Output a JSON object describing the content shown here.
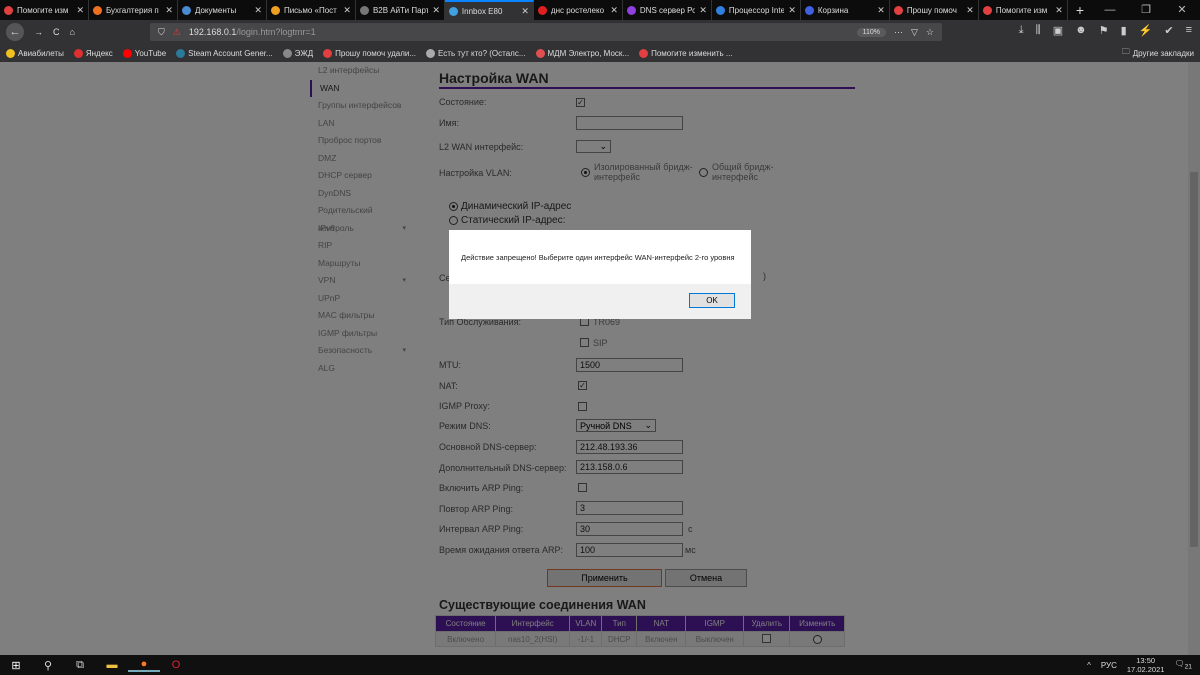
{
  "tabs": [
    {
      "label": "Помогите изм",
      "color": "#e04040"
    },
    {
      "label": "Бухгалтерия п",
      "color": "#f07020"
    },
    {
      "label": "Документы",
      "color": "#4a8ad0"
    },
    {
      "label": "Письмо «Пост",
      "color": "#f0a020"
    },
    {
      "label": "B2B АйТи Парт",
      "color": "#777777"
    },
    {
      "label": "Innbox E80",
      "color": "#40a0e0",
      "active": true
    },
    {
      "label": "днс ростелеко",
      "color": "#e02020"
    },
    {
      "label": "DNS сервер Ро",
      "color": "#9040e0"
    },
    {
      "label": "Процессор Inte",
      "color": "#3080e0"
    },
    {
      "label": "Корзина",
      "color": "#4060e0"
    },
    {
      "label": "Прошу помоч",
      "color": "#e04040"
    },
    {
      "label": "Помогите изм",
      "color": "#e04040"
    }
  ],
  "window": {
    "minimize": "—",
    "restore": "❐",
    "close": "✕",
    "new_tab": "+"
  },
  "nav": {
    "back": "←",
    "forward": "→",
    "reload": "C",
    "home": "⌂",
    "url_host": "192.168.0.1",
    "url_path": "/login.htm?logtmr=1",
    "zoom": "110%",
    "more": "···",
    "pocket": "▽",
    "star": "☆"
  },
  "toolbar_icons": [
    "⤓",
    "⫼",
    "▣",
    "☻",
    "⚑",
    "▮",
    "⚡",
    "✔",
    "≡"
  ],
  "bookmarks": [
    {
      "label": "Авиабилеты",
      "color": "#f0c020"
    },
    {
      "label": "Яндекс",
      "color": "#e03030"
    },
    {
      "label": "YouTube",
      "color": "#ff0000"
    },
    {
      "label": "Steam Account Gener...",
      "color": "#2a7a9a"
    },
    {
      "label": "ЭЖД",
      "color": "#888888"
    },
    {
      "label": "Прошу помоч удали...",
      "color": "#e04040"
    },
    {
      "label": "Есть тут кто? (Осталс...",
      "color": "#aaaaaa"
    },
    {
      "label": "МДМ Электро, Моск...",
      "color": "#e05050"
    },
    {
      "label": "Помогите изменить ...",
      "color": "#e04040"
    }
  ],
  "other_bookmarks": "Другие закладки",
  "sidebar": [
    {
      "label": "L2 интерфейсы"
    },
    {
      "label": "WAN",
      "active": true
    },
    {
      "label": "Группы интерфейсов"
    },
    {
      "label": "LAN"
    },
    {
      "label": "Проброс портов"
    },
    {
      "label": "DMZ"
    },
    {
      "label": "DHCP сервер"
    },
    {
      "label": "DynDNS"
    },
    {
      "label": "Родительский контроль"
    },
    {
      "label": "IPv6",
      "caret": "▾"
    },
    {
      "label": "RIP"
    },
    {
      "label": "Маршруты"
    },
    {
      "label": "VPN",
      "caret": "▾"
    },
    {
      "label": "UPnP"
    },
    {
      "label": "MAC фильтры"
    },
    {
      "label": "IGMP фильтры"
    },
    {
      "label": "Безопасность",
      "caret": "▾"
    },
    {
      "label": "ALG"
    }
  ],
  "form": {
    "title": "Настройка WAN",
    "state_label": "Состояние:",
    "name_label": "Имя:",
    "name_value": "",
    "l2wan_label": "L2 WAN интерфейс:",
    "vlan_label": "Настройка VLAN:",
    "vlan_opt1": "Изолированный бридж-интерфейс",
    "vlan_opt2": "Общий бридж-интерфейс",
    "ip_dynamic": "Динамический IP-адрес",
    "ip_static": "Статический IP-адрес:",
    "hidden_label_fragment": "Се",
    "hidden_paren": ")",
    "service_label": "Тип Обслуживания:",
    "tr069": "TR069",
    "sip": "SIP",
    "mtu_label": "MTU:",
    "mtu_value": "1500",
    "nat_label": "NAT:",
    "igmp_label": "IGMP Proxy:",
    "dns_mode_label": "Режим DNS:",
    "dns_mode_value": "Ручной DNS",
    "dns1_label": "Основной DNS-сервер:",
    "dns1_value": "212.48.193.36",
    "dns2_label": "Дополнительный DNS-сервер:",
    "dns2_value": "213.158.0.6",
    "arp_label": "Включить ARP Ping:",
    "arp_retry_label": "Повтор ARP Ping:",
    "arp_retry_value": "3",
    "arp_interval_label": "Интервал ARP Ping:",
    "arp_interval_value": "30",
    "arp_interval_unit": "с",
    "arp_timeout_label": "Время ожидания ответа ARP:",
    "arp_timeout_value": "100",
    "arp_timeout_unit": "мс",
    "apply": "Применить",
    "cancel": "Отмена"
  },
  "connections": {
    "title": "Существующие соединения WAN",
    "headers": [
      "Состояние",
      "Интерфейс",
      "VLAN",
      "Тип",
      "NAT",
      "IGMP",
      "Удалить",
      "Изменить"
    ],
    "row": [
      "Включено",
      "nas10_2(HSI)",
      "-1/-1",
      "DHCP",
      "Включен",
      "Выключен"
    ]
  },
  "dialog": {
    "message": "Действие запрещено! Выберите один интерфейс WAN-интерфейс 2-го уровня",
    "ok": "OK"
  },
  "taskbar": {
    "lang": "РУС",
    "time": "13:50",
    "date": "17.02.2021",
    "notifications": "21"
  }
}
